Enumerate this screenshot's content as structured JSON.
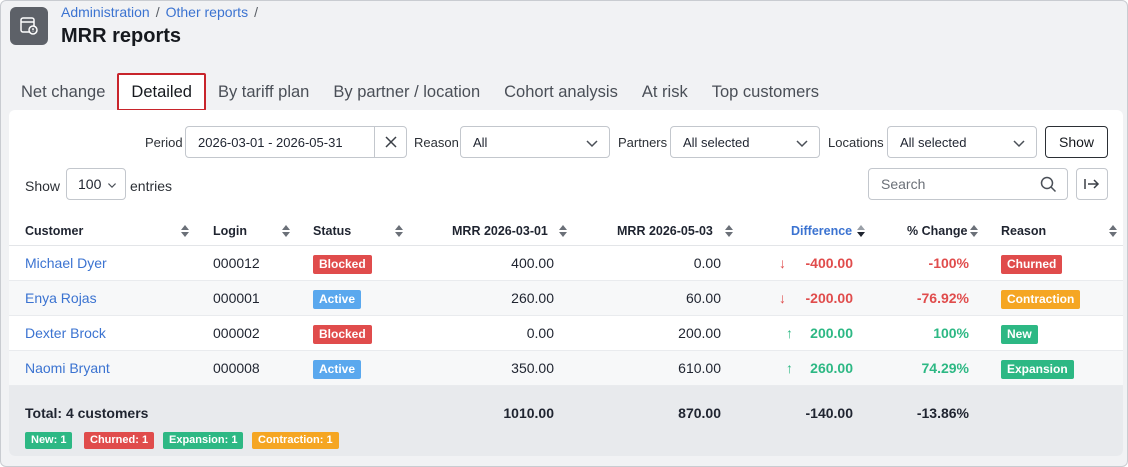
{
  "breadcrumb": {
    "admin": "Administration",
    "sep1": "/",
    "other": "Other reports",
    "sep2": "/"
  },
  "page_title": "MRR reports",
  "tabs": [
    {
      "label": "Net change",
      "active": false
    },
    {
      "label": "Detailed",
      "active": true
    },
    {
      "label": "By tariff plan",
      "active": false
    },
    {
      "label": "By partner / location",
      "active": false
    },
    {
      "label": "Cohort analysis",
      "active": false
    },
    {
      "label": "At risk",
      "active": false
    },
    {
      "label": "Top customers",
      "active": false
    }
  ],
  "filters": {
    "period_label": "Period",
    "period_value": "2026-03-01 - 2026-05-31",
    "reason_label": "Reason",
    "reason_value": "All",
    "partners_label": "Partners",
    "partners_value": "All selected",
    "locations_label": "Locations",
    "locations_value": "All selected",
    "show_button": "Show"
  },
  "controls": {
    "show_label": "Show",
    "page_size": "100",
    "entries_label": "entries",
    "search_placeholder": "Search"
  },
  "table": {
    "headers": {
      "customer": "Customer",
      "login": "Login",
      "status": "Status",
      "mrr_start": "MRR 2026-03-01",
      "mrr_end": "MRR 2026-05-03",
      "difference": "Difference",
      "pct_change": "% Change",
      "reason": "Reason"
    },
    "rows": [
      {
        "customer": "Michael Dyer",
        "login": "000012",
        "status": "Blocked",
        "mrr_start": "400.00",
        "mrr_end": "0.00",
        "difference": "-400.00",
        "pct": "-100%",
        "reason": "Churned"
      },
      {
        "customer": "Enya Rojas",
        "login": "000001",
        "status": "Active",
        "mrr_start": "260.00",
        "mrr_end": "60.00",
        "difference": "-200.00",
        "pct": "-76.92%",
        "reason": "Contraction"
      },
      {
        "customer": "Dexter Brock",
        "login": "000002",
        "status": "Blocked",
        "mrr_start": "0.00",
        "mrr_end": "200.00",
        "difference": "200.00",
        "pct": "100%",
        "reason": "New"
      },
      {
        "customer": "Naomi Bryant",
        "login": "000008",
        "status": "Active",
        "mrr_start": "350.00",
        "mrr_end": "610.00",
        "difference": "260.00",
        "pct": "74.29%",
        "reason": "Expansion"
      }
    ],
    "total": {
      "label": "Total: 4 customers",
      "mrr_start": "1010.00",
      "mrr_end": "870.00",
      "difference": "-140.00",
      "pct": "-13.86%"
    },
    "summary_badges": [
      "New: 1",
      "Churned: 1",
      "Expansion: 1",
      "Contraction: 1"
    ]
  },
  "colors": {
    "link": "#3b73d1",
    "blocked": "#e04c4c",
    "active": "#5aa8ee",
    "churned": "#e04c4c",
    "contraction": "#f5a623",
    "new": "#2db884",
    "expansion": "#2db884",
    "active_tab_border": "#c8242b"
  }
}
